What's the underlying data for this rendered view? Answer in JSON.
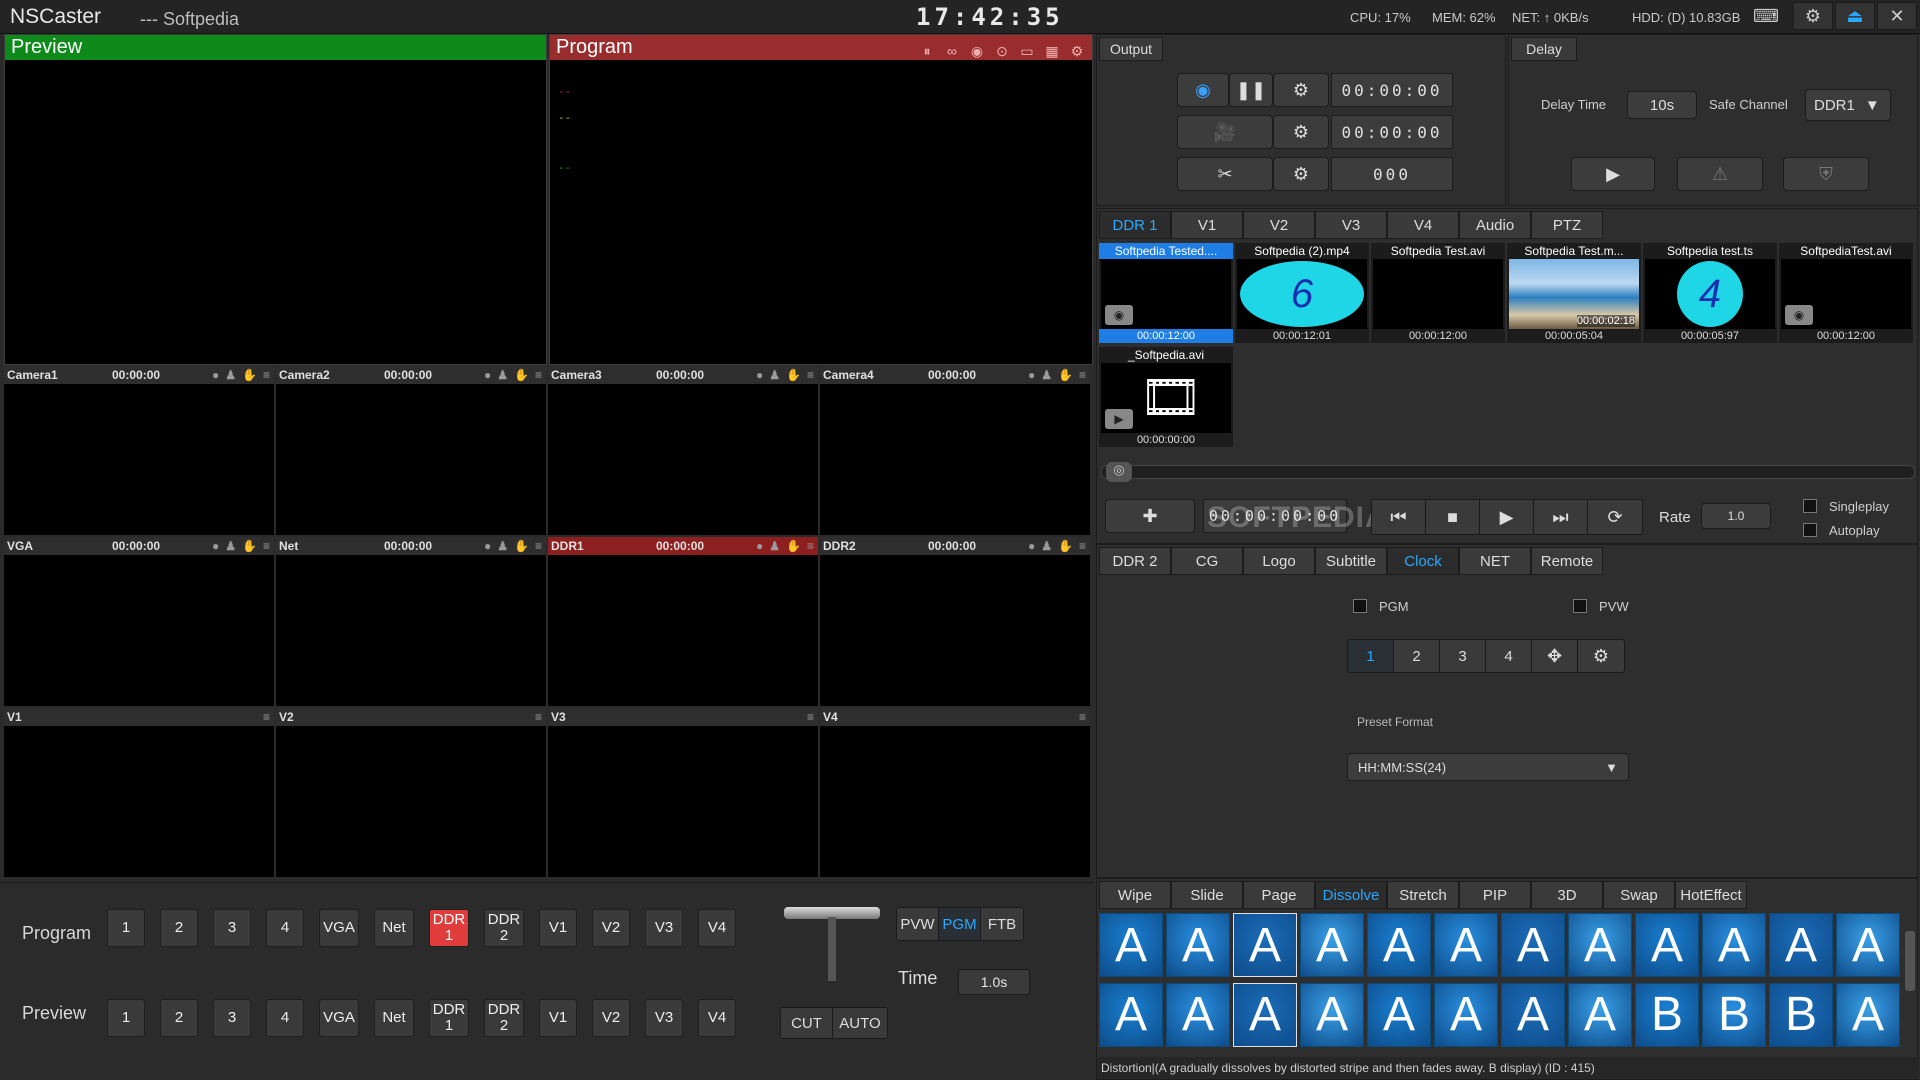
{
  "titlebar": {
    "app_name": "NSCaster",
    "doc_name": "--- Softpedia",
    "clock": "17:42:35",
    "cpu": "CPU:  17%",
    "mem": "MEM:  62%",
    "net": "NET:  ↑ 0KB/s",
    "hdd": "HDD: (D) 10.83GB"
  },
  "preview": {
    "label": "Preview"
  },
  "program": {
    "label": "Program",
    "dash_lines": [
      "--",
      "--",
      "--"
    ]
  },
  "monitors": [
    {
      "name": "Camera1",
      "tc": "00:00:00"
    },
    {
      "name": "Camera2",
      "tc": "00:00:00"
    },
    {
      "name": "Camera3",
      "tc": "00:00:00"
    },
    {
      "name": "Camera4",
      "tc": "00:00:00"
    },
    {
      "name": "VGA",
      "tc": "00:00:00"
    },
    {
      "name": "Net",
      "tc": "00:00:00"
    },
    {
      "name": "DDR1",
      "tc": "00:00:00",
      "active": true
    },
    {
      "name": "DDR2",
      "tc": "00:00:00"
    },
    {
      "name": "V1",
      "tc": ""
    },
    {
      "name": "V2",
      "tc": ""
    },
    {
      "name": "V3",
      "tc": ""
    },
    {
      "name": "V4",
      "tc": ""
    }
  ],
  "switcher": {
    "program_label": "Program",
    "preview_label": "Preview",
    "buttons": [
      "1",
      "2",
      "3",
      "4",
      "VGA",
      "Net",
      "DDR 1",
      "DDR 2",
      "V1",
      "V2",
      "V3",
      "V4"
    ],
    "program_active": "DDR 1",
    "modes": [
      "PVW",
      "PGM",
      "FTB"
    ],
    "mode_active": "PGM",
    "time_label": "Time",
    "time_value": "1.0s",
    "cut_label": "CUT",
    "auto_label": "AUTO"
  },
  "output": {
    "tab": "Output",
    "record_tc": "00:00:00",
    "stream_tc": "00:00:00",
    "clip_count": "000"
  },
  "delay": {
    "tab": "Delay",
    "delay_time_label": "Delay Time",
    "delay_time_value": "10s",
    "safe_channel_label": "Safe Channel",
    "safe_channel_value": "DDR1"
  },
  "media_tabs": [
    "DDR 1",
    "V1",
    "V2",
    "V3",
    "V4",
    "Audio",
    "PTZ"
  ],
  "media_tab_active": "DDR 1",
  "media_items": [
    {
      "title": "Softpedia Tested....",
      "duration": "00:00:12:00",
      "selected": true,
      "kind": "blank"
    },
    {
      "title": "Softpedia (2).mp4",
      "duration": "00:00:12:01",
      "kind": "clock6"
    },
    {
      "title": "Softpedia Test.avi",
      "duration": "00:00:12:00",
      "kind": "black"
    },
    {
      "title": "Softpedia Test.m...",
      "duration": "00:00:05:04",
      "kind": "beach",
      "overlay": "00:00:02:18"
    },
    {
      "title": "Softpedia test.ts",
      "duration": "00:00:05:97",
      "kind": "clock4"
    },
    {
      "title": "SoftpediaTest.avi",
      "duration": "00:00:12:00",
      "kind": "blank"
    },
    {
      "title": "_Softpedia.avi",
      "duration": "00:00:00:00",
      "kind": "film"
    }
  ],
  "playback": {
    "timecode": "00:00:00:00",
    "rate_label": "Rate",
    "rate_value": "1.0",
    "singleplay": "Singleplay",
    "autoplay": "Autoplay",
    "watermark": "SOFTPEDIA"
  },
  "graphics_tabs": [
    "DDR 2",
    "CG",
    "Logo",
    "Subtitle",
    "Clock",
    "NET",
    "Remote"
  ],
  "graphics_tab_active": "Clock",
  "clock_panel": {
    "pgm": "PGM",
    "pvw": "PVW",
    "slots": [
      "1",
      "2",
      "3",
      "4"
    ],
    "slot_active": "1",
    "preset_label": "Preset Format",
    "preset_value": "HH:MM:SS(24)"
  },
  "transition_tabs": [
    "Wipe",
    "Slide",
    "Page",
    "Dissolve",
    "Stretch",
    "PIP",
    "3D",
    "Swap",
    "HotEffect"
  ],
  "transition_tab_active": "Dissolve",
  "effect_glyphs": [
    "A",
    "A",
    "A",
    "A",
    "A",
    "A",
    "A",
    "A",
    "A",
    "A",
    "A",
    "A",
    "A",
    "A",
    "A",
    "A",
    "A",
    "A",
    "A",
    "A",
    "B",
    "B",
    "B",
    "A"
  ],
  "status_text": "Distortion|(A gradually dissolves by distorted stripe and then fades away. B display) (ID : 415)",
  "colors": {
    "accent": "#28a8ff",
    "preview_green": "#0d8a1a",
    "program_red": "#992d2d",
    "active_red": "#e03c3c",
    "effect_blue": "#1a7fd0"
  }
}
